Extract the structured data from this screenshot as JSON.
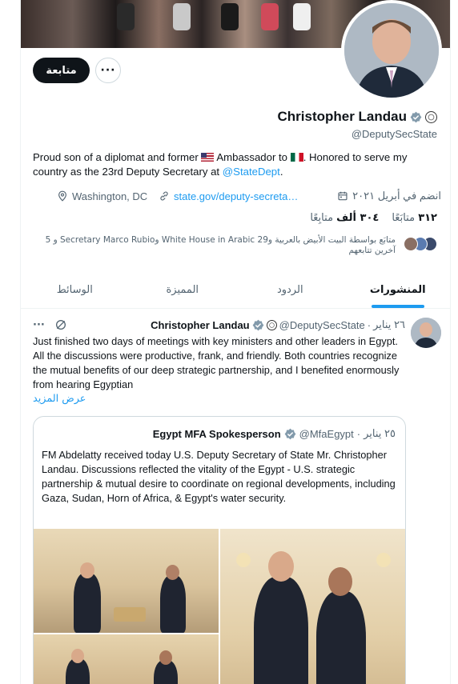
{
  "profile": {
    "follow_button": "متابعة",
    "more_button": "···",
    "name": "Christopher Landau",
    "handle": "@DeputySecState",
    "bio_part1": "Proud son of a diplomat and former ",
    "bio_part2": " Ambassador to ",
    "bio_part3": ". Honored to serve my country as the 23rd Deputy Secretary at ",
    "bio_link": "@StateDept",
    "bio_part4": ".",
    "location": "Washington, DC",
    "website": "state.gov/deputy-secreta…",
    "joined": "انضم في أبريل ٢٠٢١",
    "following_count": "٣١٢",
    "following_label": "متابَعًا",
    "followers_count": "٣٠٤ ألف",
    "followers_label": "متابِعًا",
    "followed_by": "متابَع بواسطة البيت الأبيض بالعربية وWhite House in Arabic 29 وSecretary Marco Rubio و 5 آخرين تتابعهم"
  },
  "tabs": {
    "posts": "المنشورات",
    "replies": "الردود",
    "highlights": "المميزة",
    "media": "الوسائط"
  },
  "tweet": {
    "author": "Christopher Landau",
    "handle": "@DeputySecState",
    "date": "٢٦ يناير",
    "text": "Just finished two days of meetings with key ministers and other leaders in Egypt. All the discussions were productive, frank, and friendly. Both countries recognize the mutual benefits of our deep strategic partnership, and I benefited enormously from hearing Egyptian",
    "show_more": "عرض المزيد",
    "more_icon": "···"
  },
  "quote": {
    "author": "Egypt MFA Spokesperson",
    "handle": "@MfaEgypt",
    "date": "٢٥ يناير",
    "text": "FM Abdelatty received today U.S. Deputy Secretary of State Mr. Christopher Landau. Discussions reflected the vitality of the Egypt - U.S. strategic partnership & mutual desire to coordinate on regional developments, including Gaza, Sudan, Horn of Africa, & Egypt's water security."
  },
  "colors": {
    "accent": "#1d9bf0",
    "text": "#0f1419",
    "muted": "#536471",
    "border": "#eff3f4"
  }
}
